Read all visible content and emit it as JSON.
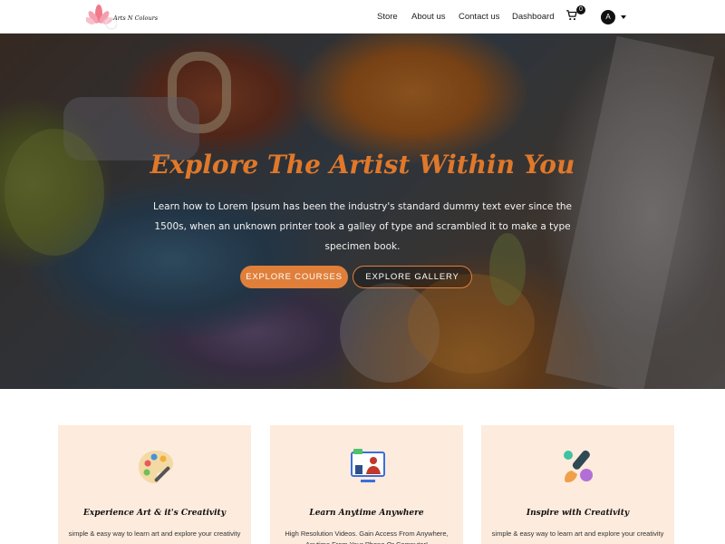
{
  "brand": {
    "logo_text": "Arts N Colours"
  },
  "nav": {
    "links": [
      "Store",
      "About us",
      "Contact us",
      "Dashboard"
    ],
    "cart_count": "0",
    "avatar_initial": "A"
  },
  "hero": {
    "title": "Explore The Artist Within You",
    "text": "Learn how to Lorem Ipsum has been the industry's standard dummy text ever since the 1500s, when an unknown printer took a galley of type and scrambled it to make a type specimen book.",
    "primary_button": "EXPLORE COURSES",
    "secondary_button": "EXPLORE GALLERY"
  },
  "cards": [
    {
      "icon": "palette-icon",
      "title": "Experience Art & it's Creativity",
      "text": "simple & easy way to learn art and explore your creativity"
    },
    {
      "icon": "online-learning-icon",
      "title": "Learn Anytime Anywhere",
      "text": "High Resolution Videos. Gain Access From Anywhere, Anytime From Your Phone Or Computer!"
    },
    {
      "icon": "brush-icon",
      "title": "Inspire with Creativity",
      "text": "simple & easy way to learn art and explore your creativity"
    }
  ],
  "colors": {
    "accent": "#e07f3a",
    "card_bg": "#fdebdd"
  }
}
